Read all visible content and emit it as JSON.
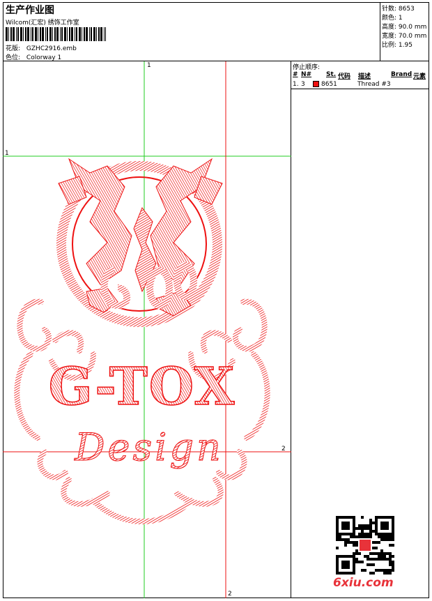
{
  "header": {
    "title": "生产作业图",
    "subtitle": "Wilcom(汇宏) 绣饰工作室",
    "design_label": "花版:",
    "design_value": "GZHC2916.emb",
    "color_label": "色位:",
    "color_value": "Colorway 1"
  },
  "stats": [
    {
      "label": "针数:",
      "value": "8653"
    },
    {
      "label": "颜色:",
      "value": "1"
    },
    {
      "label": "高度:",
      "value": "90.0 mm"
    },
    {
      "label": "宽度:",
      "value": "70.0 mm"
    },
    {
      "label": "比例:",
      "value": "1.95"
    }
  ],
  "stop_sequence": {
    "title": "停止顺序:",
    "columns": [
      "#",
      "N#",
      "St.",
      "代码",
      "描述",
      "Brand",
      "元素"
    ],
    "rows": [
      {
        "index": "1.",
        "needle": "3",
        "code": "8651",
        "description": "Thread #3",
        "swatch_color": "#e11111"
      }
    ]
  },
  "canvas": {
    "guide_labels": [
      "1",
      "1",
      "2",
      "2"
    ],
    "design_text_main": "G-TOX",
    "design_text_script": "Design",
    "thread_color": "#ee1111",
    "guide_green": "#22cc22",
    "guide_red": "#ee1111"
  },
  "watermark": {
    "site": "6xiu.com"
  }
}
